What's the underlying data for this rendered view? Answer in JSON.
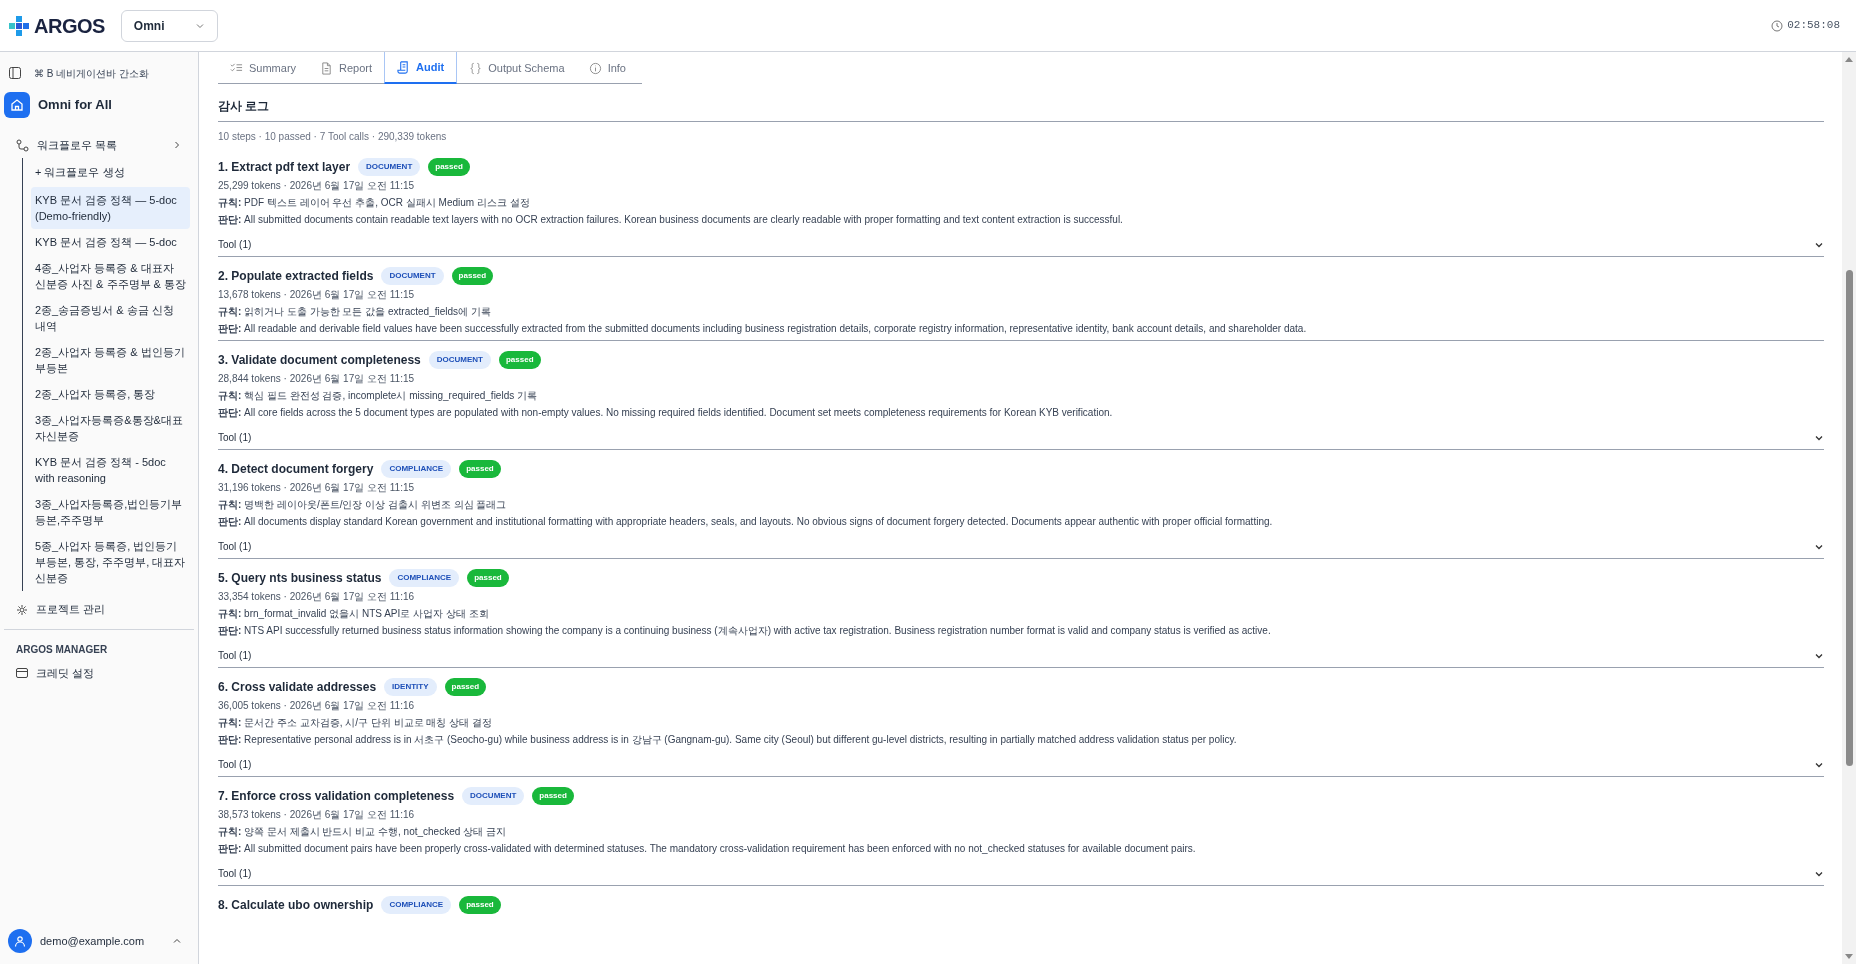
{
  "header": {
    "logo": "ARGOS",
    "project_select": "Omni",
    "clock": "02:58:08"
  },
  "sidebar": {
    "shortcut_hint": "⌘ B 네비게이션바 간소화",
    "workspace": "Omni for All",
    "workflows_label": "워크플로우 목록",
    "create_label": "+ 워크플로우 생성",
    "items": [
      {
        "label": "KYB 문서 검증 정책 — 5-doc (Demo-friendly)",
        "selected": true
      },
      {
        "label": "KYB 문서 검증 정책 — 5-doc",
        "selected": false
      },
      {
        "label": "4종_사업자 등록증 & 대표자 신분증 사진 & 주주명부 & 통장",
        "selected": false
      },
      {
        "label": "2종_송금증빙서 & 송금 신청 내역",
        "selected": false
      },
      {
        "label": "2종_사업자 등록증 & 법인등기부등본",
        "selected": false
      },
      {
        "label": "2종_사업자 등록증, 통장",
        "selected": false
      },
      {
        "label": "3종_사업자등록증&통장&대표자신분증",
        "selected": false
      },
      {
        "label": "KYB 문서 검증 정책 - 5doc with reasoning",
        "selected": false
      },
      {
        "label": "3종_사업자등록증,법인등기부등본,주주명부",
        "selected": false
      },
      {
        "label": "5종_사업자 등록증, 법인등기부등본, 통장, 주주명부, 대표자 신분증",
        "selected": false
      }
    ],
    "project_manage": "프로젝트 관리",
    "manager_heading": "ARGOS MANAGER",
    "credit_settings": "크레딧 설정",
    "user_email": "demo@example.com"
  },
  "tabs": [
    {
      "label": "Summary",
      "selected": false
    },
    {
      "label": "Report",
      "selected": false
    },
    {
      "label": "Audit",
      "selected": true
    },
    {
      "label": "Output Schema",
      "selected": false
    },
    {
      "label": "Info",
      "selected": false
    }
  ],
  "audit": {
    "title": "감사 로그",
    "summary": "10 steps · 10 passed · 7 Tool calls · 290,339 tokens",
    "steps": [
      {
        "title": "1. Extract pdf text layer",
        "category": "DOCUMENT",
        "status": "passed",
        "meta": "25,299 tokens · 2026년 6월 17일 오전 11:15",
        "rule_label": "규칙:",
        "rule": "PDF 텍스트 레이어 우선 추출, OCR 실패시 Medium 리스크 설정",
        "judgment_label": "판단:",
        "judgment": "All submitted documents contain readable text layers with no OCR extraction failures. Korean business documents are clearly readable with proper formatting and text content extraction is successful.",
        "tool": "Tool (1)"
      },
      {
        "title": "2. Populate extracted fields",
        "category": "DOCUMENT",
        "status": "passed",
        "meta": "13,678 tokens · 2026년 6월 17일 오전 11:15",
        "rule_label": "규칙:",
        "rule": "읽히거나 도출 가능한 모든 값을 extracted_fields에 기록",
        "judgment_label": "판단:",
        "judgment": "All readable and derivable field values have been successfully extracted from the submitted documents including business registration details, corporate registry information, representative identity, bank account details, and shareholder data."
      },
      {
        "title": "3. Validate document completeness",
        "category": "DOCUMENT",
        "status": "passed",
        "meta": "28,844 tokens · 2026년 6월 17일 오전 11:15",
        "rule_label": "규칙:",
        "rule": "핵심 필드 완전성 검증, incomplete시 missing_required_fields 기록",
        "judgment_label": "판단:",
        "judgment": "All core fields across the 5 document types are populated with non-empty values. No missing required fields identified. Document set meets completeness requirements for Korean KYB verification.",
        "tool": "Tool (1)"
      },
      {
        "title": "4. Detect document forgery",
        "category": "COMPLIANCE",
        "status": "passed",
        "meta": "31,196 tokens · 2026년 6월 17일 오전 11:15",
        "rule_label": "규칙:",
        "rule": "명백한 레이아웃/폰트/인장 이상 검출시 위변조 의심 플래그",
        "judgment_label": "판단:",
        "judgment": "All documents display standard Korean government and institutional formatting with appropriate headers, seals, and layouts. No obvious signs of document forgery detected. Documents appear authentic with proper official formatting.",
        "tool": "Tool (1)"
      },
      {
        "title": "5. Query nts business status",
        "category": "COMPLIANCE",
        "status": "passed",
        "meta": "33,354 tokens · 2026년 6월 17일 오전 11:16",
        "rule_label": "규칙:",
        "rule": "brn_format_invalid 없을시 NTS API로 사업자 상태 조회",
        "judgment_label": "판단:",
        "judgment": "NTS API successfully returned business status information showing the company is a continuing business (계속사업자) with active tax registration. Business registration number format is valid and company status is verified as active.",
        "tool": "Tool (1)"
      },
      {
        "title": "6. Cross validate addresses",
        "category": "IDENTITY",
        "status": "passed",
        "meta": "36,005 tokens · 2026년 6월 17일 오전 11:16",
        "rule_label": "규칙:",
        "rule": "문서간 주소 교차검증, 시/구 단위 비교로 매칭 상태 결정",
        "judgment_label": "판단:",
        "judgment": "Representative personal address is in 서초구 (Seocho-gu) while business address is in 강남구 (Gangnam-gu). Same city (Seoul) but different gu-level districts, resulting in partially matched address validation status per policy.",
        "tool": "Tool (1)"
      },
      {
        "title": "7. Enforce cross validation completeness",
        "category": "DOCUMENT",
        "status": "passed",
        "meta": "38,573 tokens · 2026년 6월 17일 오전 11:16",
        "rule_label": "규칙:",
        "rule": "양쪽 문서 제출시 반드시 비교 수행, not_checked 상태 금지",
        "judgment_label": "판단:",
        "judgment": "All submitted document pairs have been properly cross-validated with determined statuses. The mandatory cross-validation requirement has been enforced with no not_checked statuses for available document pairs.",
        "tool": "Tool (1)"
      },
      {
        "title": "8. Calculate ubo ownership",
        "category": "COMPLIANCE",
        "status": "passed"
      }
    ]
  }
}
